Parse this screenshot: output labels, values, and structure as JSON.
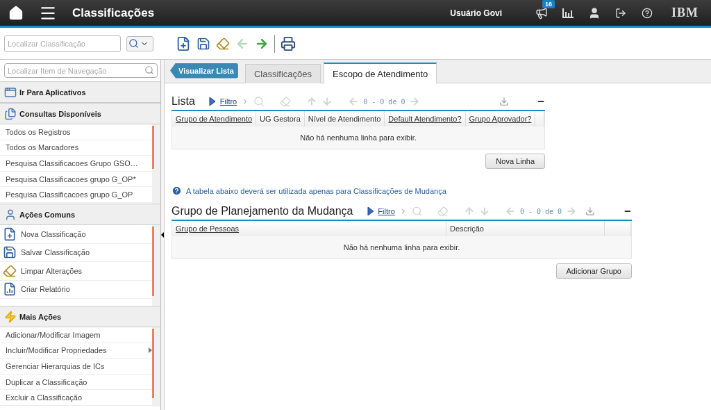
{
  "header": {
    "title": "Classificações",
    "user": "Usuário Govi",
    "notification_count": "16",
    "logo": "IBM"
  },
  "toolbar": {
    "search_placeholder": "Localizar Classificação"
  },
  "sidebar": {
    "search_placeholder": "Localizar Item de Navegação",
    "sections": [
      {
        "title": "Ir Para Aplicativos"
      },
      {
        "title": "Consultas Disponíveis",
        "items": [
          {
            "label": "Todos os Registros",
            "submenu": false
          },
          {
            "label": "Todos os Marcadores",
            "submenu": false
          },
          {
            "label": "Pesquisa Classificacoes Grupo GSO…",
            "submenu": false
          },
          {
            "label": "Pesquisa Classificacoes grupo G_OP*",
            "submenu": false
          },
          {
            "label": "Pesquisa Classificacoes grupo G_OP",
            "submenu": false
          }
        ]
      },
      {
        "title": "Ações Comuns",
        "items": [
          {
            "label": "Nova Classificação",
            "submenu": false
          },
          {
            "label": "Salvar Classificação",
            "submenu": false
          },
          {
            "label": "Limpar Alterações",
            "submenu": false
          },
          {
            "label": "Criar Relatório",
            "submenu": false
          }
        ]
      },
      {
        "title": "Mais Ações",
        "items": [
          {
            "label": "Adicionar/Modificar Imagem",
            "submenu": false
          },
          {
            "label": "Incluir/Modificar Propriedades",
            "submenu": true
          },
          {
            "label": "Gerenciar Hierarquias de ICs",
            "submenu": false
          },
          {
            "label": "Duplicar a Classificação",
            "submenu": false
          },
          {
            "label": "Excluir a Classificação",
            "submenu": false
          }
        ]
      }
    ]
  },
  "main": {
    "back_button": "Visualizar Lista",
    "tabs": [
      {
        "label": "Classificações",
        "selected": false
      },
      {
        "label": "Escopo de Atendimento",
        "selected": true
      }
    ],
    "sections": [
      {
        "kind": "table",
        "title": "Lista",
        "filter": "Filtro",
        "pager": "0 - 0 de 0",
        "columns": [
          {
            "label": "Grupo de Atendimento",
            "sortable": true
          },
          {
            "label": "UG Gestora",
            "sortable": false
          },
          {
            "label": "Nível de Atendimento",
            "sortable": false
          },
          {
            "label": "Default Atendimento?",
            "sortable": true
          },
          {
            "label": "Grupo Aprovador?",
            "sortable": true
          }
        ],
        "empty_message": "Não há nenhuma linha para exibir.",
        "button": "Nova Linha"
      },
      {
        "kind": "info",
        "text": "A tabela abaixo deverá ser utilizada apenas para Classificações de Mudança"
      },
      {
        "kind": "table",
        "title": "Grupo de Planejamento da Mudança",
        "filter": "Filtro",
        "pager": "0 - 0 de 0",
        "columns": [
          {
            "label": "Grupo de Pessoas",
            "sortable": true
          },
          {
            "label": "Descrição",
            "sortable": false
          }
        ],
        "empty_message": "Não há nenhuma linha para exibir.",
        "button": "Adicionar Grupo"
      }
    ]
  }
}
